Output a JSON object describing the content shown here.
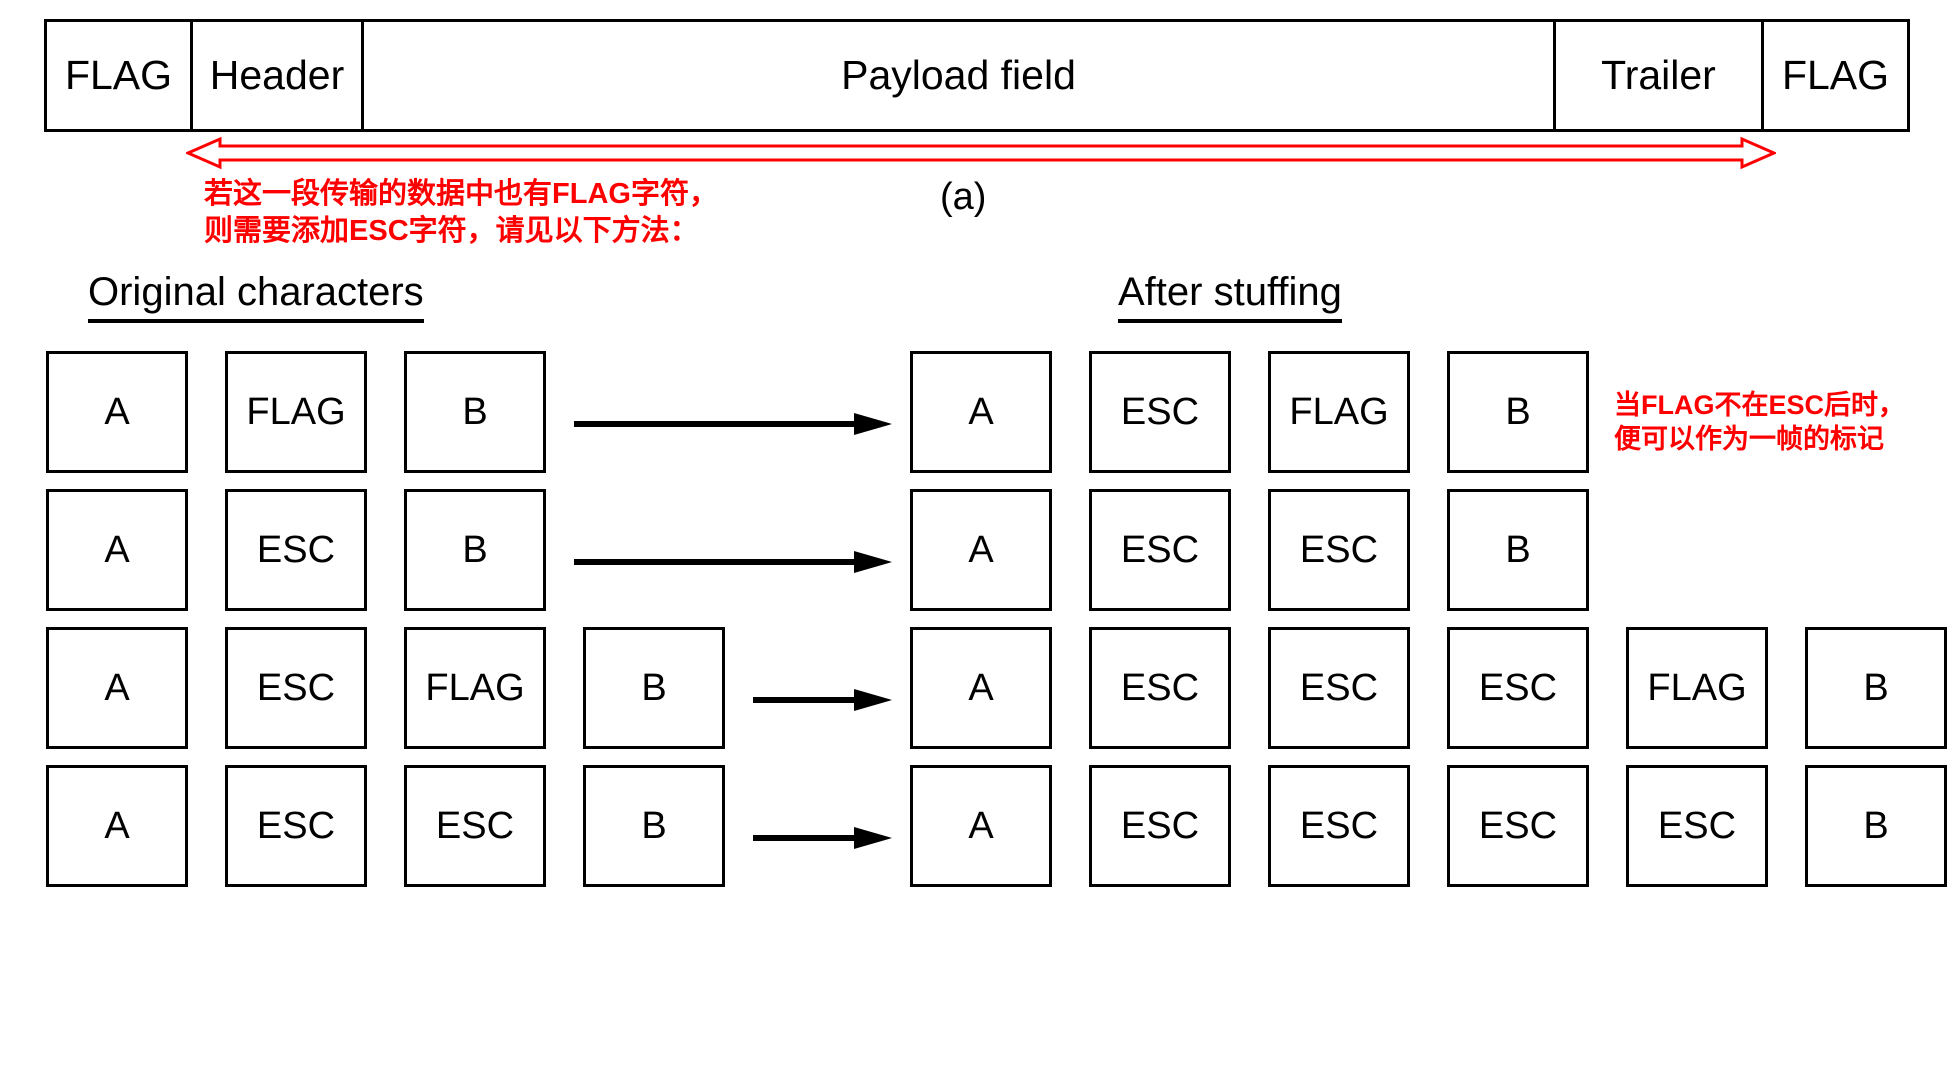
{
  "frame": {
    "cells": [
      {
        "label": "FLAG"
      },
      {
        "label": "Header"
      },
      {
        "label": "Payload field"
      },
      {
        "label": "Trailer"
      },
      {
        "label": "FLAG"
      }
    ],
    "caption": "(a)"
  },
  "notes": {
    "left": {
      "line1_pre": "若这一段传输的数据中也有",
      "line1_em": "FLAG",
      "line1_post": "字符，",
      "line2_pre": "则需要添加",
      "line2_em": "ESC",
      "line2_post": "字符，请见以下方法："
    },
    "right": {
      "line1_pre": "当",
      "line1_em1": "FLAG",
      "line1_mid": "不在",
      "line1_em2": "ESC",
      "line1_post": "后时，",
      "line2": "便可以作为一帧的标记"
    }
  },
  "headings": {
    "original": "Original characters",
    "stuffed": "After stuffing"
  },
  "rows": [
    {
      "original": [
        "A",
        "FLAG",
        "B"
      ],
      "stuffed": [
        "A",
        "ESC",
        "FLAG",
        "B"
      ]
    },
    {
      "original": [
        "A",
        "ESC",
        "B"
      ],
      "stuffed": [
        "A",
        "ESC",
        "ESC",
        "B"
      ]
    },
    {
      "original": [
        "A",
        "ESC",
        "FLAG",
        "B"
      ],
      "stuffed": [
        "A",
        "ESC",
        "ESC",
        "ESC",
        "FLAG",
        "B"
      ]
    },
    {
      "original": [
        "A",
        "ESC",
        "ESC",
        "B"
      ],
      "stuffed": [
        "A",
        "ESC",
        "ESC",
        "ESC",
        "ESC",
        "B"
      ]
    }
  ],
  "colors": {
    "annotation": "#ff0000",
    "line": "#000000",
    "background": "#ffffff"
  }
}
